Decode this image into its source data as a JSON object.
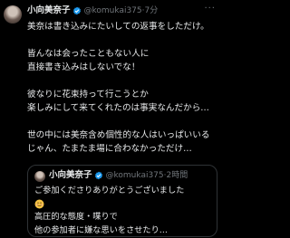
{
  "tweet": {
    "author_name": "小向美奈子",
    "handle": "@komukai375",
    "separator": "·",
    "time": "7分",
    "more": "···",
    "lines": [
      "美奈は書き込みにたいしての返事をしただけ。",
      "",
      "皆んなは会ったこともない人に",
      "直接書き込みはしないでな！",
      "",
      "彼なりに花束持って行こうとか",
      "楽しみにして来てくれたのは事実なんだから…",
      "",
      "世の中には美奈含め個性的な人はいっぱいいる",
      "じゃん、たまたま場に合わなかっただけ…"
    ]
  },
  "quote": {
    "author_name": "小向美奈子",
    "handle": "@komukai375",
    "separator": "·",
    "time": "2時間",
    "line1": "ご参加くださりありがとうございました",
    "emoji": "smiling-face-emoji",
    "line2": "高圧的な態度・喋りで",
    "line3": "他の参加者に嫌な思いをさせたり…"
  },
  "colors": {
    "background": "#000000",
    "text": "#e7e9ea",
    "secondary": "#71767b",
    "verified": "#1d9bf0",
    "border": "#2f3336"
  }
}
